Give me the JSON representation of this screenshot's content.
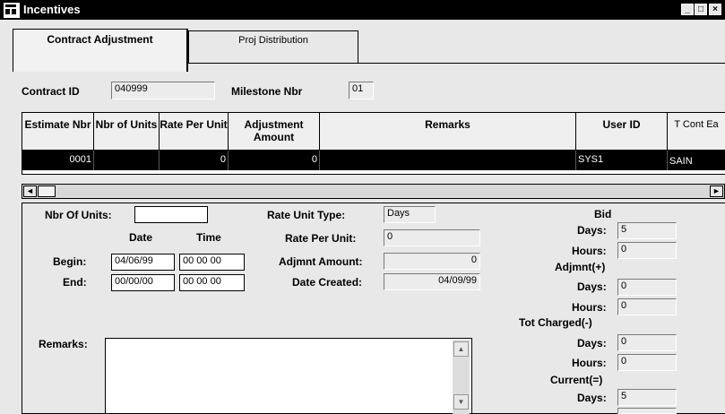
{
  "window": {
    "title": "Incentives",
    "min": "_",
    "max": "□",
    "close": "×"
  },
  "tabs": [
    {
      "label": "Contract Adjustment"
    },
    {
      "label": "Proj Distribution"
    }
  ],
  "header": {
    "contract_id_label": "Contract ID",
    "contract_id_value": "040999",
    "milestone_label": "Milestone Nbr",
    "milestone_value": "01"
  },
  "grid": {
    "columns": [
      {
        "label": "Estimate Nbr"
      },
      {
        "label": "Nbr of Units"
      },
      {
        "label": "Rate Per Unit"
      },
      {
        "label": "Adjustment Amount"
      },
      {
        "label": "Remarks"
      },
      {
        "label": "User ID"
      },
      {
        "label": "T Cont Ea"
      }
    ],
    "rows": [
      {
        "estimate_nbr": "0001",
        "nbr_units": "",
        "rate": "0",
        "adjustment": "0",
        "remarks": "",
        "user_id": "SYS1",
        "t_cont": "SAIN"
      }
    ]
  },
  "form": {
    "nbr_units_label": "Nbr Of Units:",
    "nbr_units_value": "",
    "date_header": "Date",
    "time_header": "Time",
    "begin_label": "Begin:",
    "begin_date": "04/06/99",
    "begin_time": "00 00 00",
    "end_label": "End:",
    "end_date": "00/00/00",
    "end_time": "00 00 00",
    "rate_unit_type_label": "Rate Unit Type:",
    "rate_unit_type_value": "Days",
    "rate_per_unit_label": "Rate Per Unit:",
    "rate_per_unit_value": "0",
    "adjmnt_amount_label": "Adjmnt Amount:",
    "adjmnt_amount_value": "0",
    "date_created_label": "Date Created:",
    "date_created_value": "04/09/99",
    "remarks_label": "Remarks:"
  },
  "summary": {
    "bid_label": "Bid",
    "bid_days_label": "Days:",
    "bid_days": "5",
    "bid_hours_label": "Hours:",
    "bid_hours": "0",
    "adj_label": "Adjmnt(+)",
    "adj_days_label": "Days:",
    "adj_days": "0",
    "adj_hours_label": "Hours:",
    "adj_hours": "0",
    "tot_label": "Tot Charged(-)",
    "tot_days_label": "Days:",
    "tot_days": "0",
    "tot_hours_label": "Hours:",
    "tot_hours": "0",
    "cur_label": "Current(=)",
    "cur_days_label": "Days:",
    "cur_days": "5"
  },
  "icons": {
    "app": "app-window-icon",
    "scroll_left": "◄",
    "scroll_right": "►",
    "scroll_up": "▲",
    "scroll_down": "▼"
  }
}
